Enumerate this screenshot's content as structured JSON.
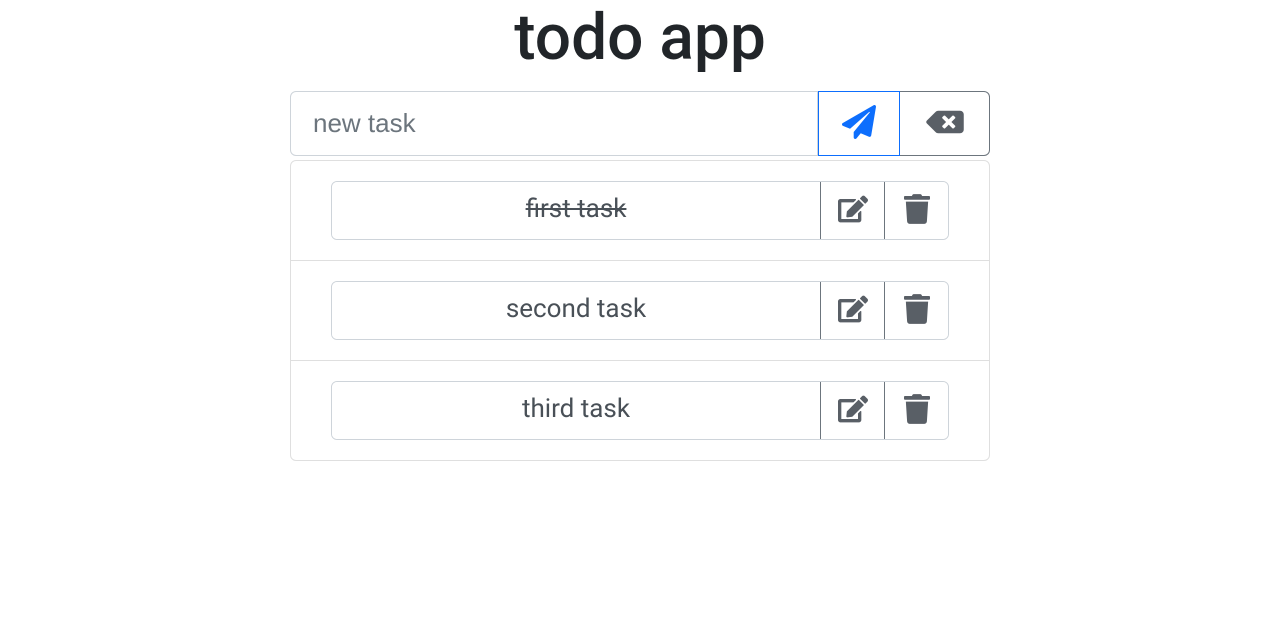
{
  "title": "todo app",
  "input": {
    "placeholder": "new task",
    "value": ""
  },
  "icons": {
    "send": "paper-plane-icon",
    "clear": "backspace-icon",
    "edit": "edit-icon",
    "delete": "trash-icon"
  },
  "colors": {
    "primary": "#0d6efd",
    "secondary": "#6c757d",
    "iconGray": "#595f66",
    "border": "#ced4da"
  },
  "tasks": [
    {
      "text": "first task",
      "done": true
    },
    {
      "text": "second task",
      "done": false
    },
    {
      "text": "third task",
      "done": false
    }
  ]
}
